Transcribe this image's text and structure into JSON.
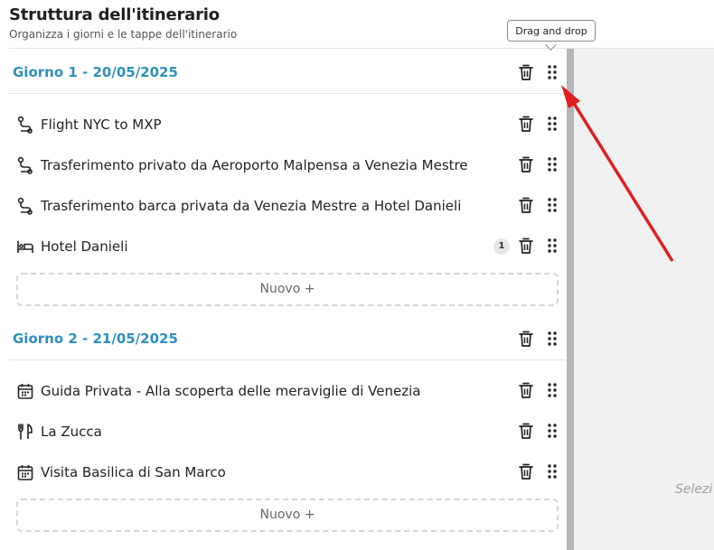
{
  "header": {
    "title": "Struttura dell'itinerario",
    "subtitle": "Organizza i giorni e le tappe dell'itinerario"
  },
  "tooltip": {
    "text": "Drag and drop"
  },
  "days": [
    {
      "title": "Giorno 1 - 20/05/2025",
      "items": [
        {
          "label": "Flight NYC to MXP",
          "icon": "route-icon"
        },
        {
          "label": "Trasferimento privato da Aeroporto Malpensa a Venezia Mestre",
          "icon": "route-icon"
        },
        {
          "label": "Trasferimento barca privata da Venezia Mestre a Hotel Danieli",
          "icon": "route-icon"
        },
        {
          "label": "Hotel Danieli",
          "icon": "bed-icon",
          "badge": "1"
        }
      ],
      "new_label": "Nuovo +"
    },
    {
      "title": "Giorno 2 - 21/05/2025",
      "items": [
        {
          "label": "Guida Privata - Alla scoperta delle meraviglie di Venezia",
          "icon": "calendar-icon"
        },
        {
          "label": "La Zucca",
          "icon": "utensils-icon"
        },
        {
          "label": "Visita Basilica di San Marco",
          "icon": "calendar-icon"
        }
      ],
      "new_label": "Nuovo +"
    }
  ],
  "right_panel": {
    "text": "Selezi"
  },
  "colors": {
    "day_title": "#2e8fbe",
    "annotation_arrow": "#e02020"
  }
}
